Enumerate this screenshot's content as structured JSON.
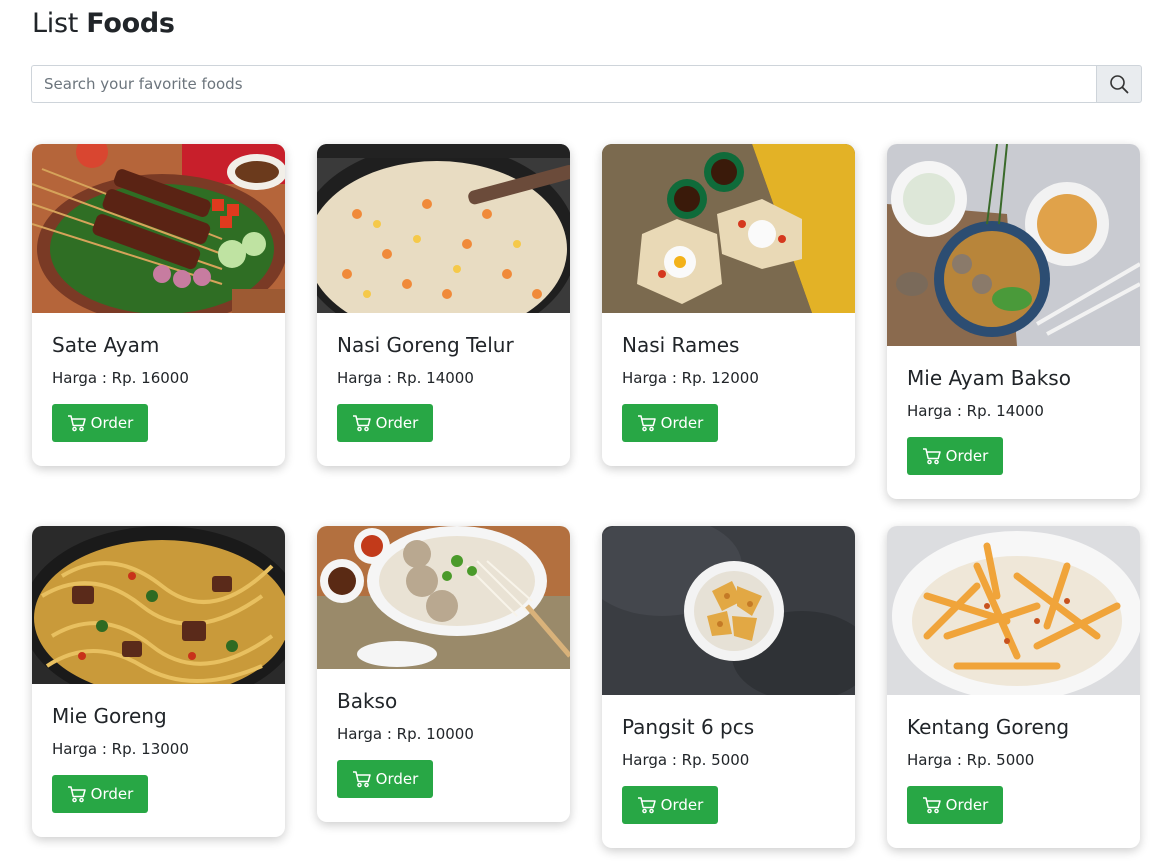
{
  "header": {
    "title_light": "List",
    "title_bold": "Foods"
  },
  "search": {
    "placeholder": "Search your favorite foods",
    "icon": "search-icon"
  },
  "foods": [
    {
      "name": "Sate Ayam",
      "price": "Harga : Rp. 16000",
      "order_label": "Order"
    },
    {
      "name": "Nasi Goreng Telur",
      "price": "Harga : Rp. 14000",
      "order_label": "Order"
    },
    {
      "name": "Nasi Rames",
      "price": "Harga : Rp. 12000",
      "order_label": "Order"
    },
    {
      "name": "Mie Ayam Bakso",
      "price": "Harga : Rp. 14000",
      "order_label": "Order"
    },
    {
      "name": "Mie Goreng",
      "price": "Harga : Rp. 13000",
      "order_label": "Order"
    },
    {
      "name": "Bakso",
      "price": "Harga : Rp. 10000",
      "order_label": "Order"
    },
    {
      "name": "Pangsit 6 pcs",
      "price": "Harga : Rp. 5000",
      "order_label": "Order"
    },
    {
      "name": "Kentang Goreng",
      "price": "Harga : Rp. 5000",
      "order_label": "Order"
    }
  ],
  "colors": {
    "order_button": "#28a745",
    "search_button_bg": "#e9ecef"
  }
}
